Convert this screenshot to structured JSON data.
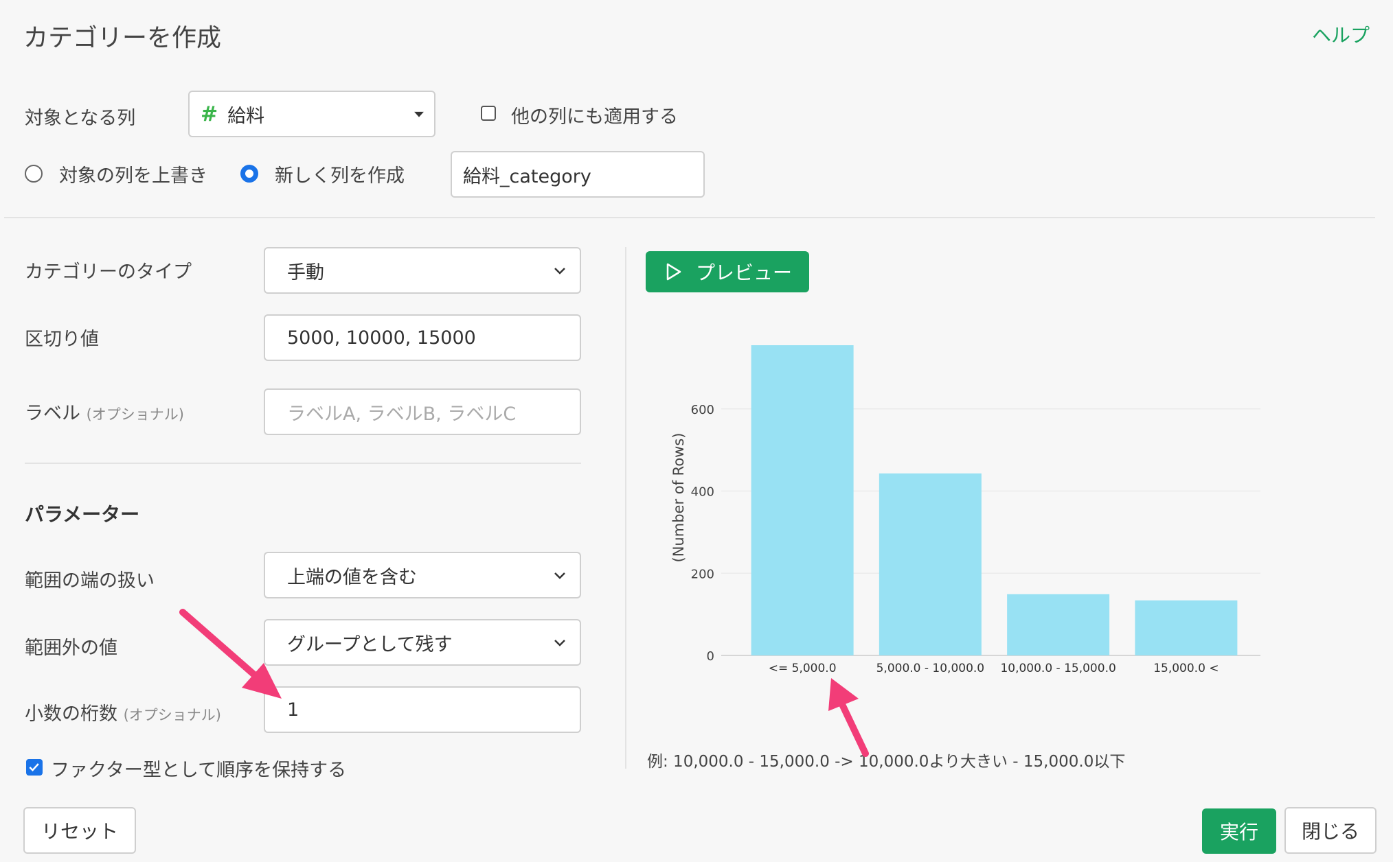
{
  "header": {
    "title": "カテゴリーを作成",
    "help": "ヘルプ"
  },
  "target": {
    "label": "対象となる列",
    "column_value": "給料",
    "apply_other_label": "他の列にも適用する",
    "overwrite_label": "対象の列を上書き",
    "new_column_label": "新しく列を作成",
    "new_column_value": "給料_category"
  },
  "form": {
    "category_type_label": "カテゴリーのタイプ",
    "category_type_value": "手動",
    "breaks_label": "区切り値",
    "breaks_value": "5000, 10000, 15000",
    "labels_label": "ラベル",
    "labels_optional": "(オプショナル)",
    "labels_placeholder": "ラベルA, ラベルB, ラベルC",
    "params_heading": "パラメーター",
    "range_edge_label": "範囲の端の扱い",
    "range_edge_value": "上端の値を含む",
    "out_of_range_label": "範囲外の値",
    "out_of_range_value": "グループとして残す",
    "decimals_label": "小数の桁数",
    "decimals_optional": "(オプショナル)",
    "decimals_value": "1",
    "factor_label": "ファクター型として順序を保持する"
  },
  "preview": {
    "button_label": "プレビュー",
    "example_text": "例: 10,000.0 - 15,000.0 -> 10,000.0より大きい - 15,000.0以下"
  },
  "footer": {
    "reset": "リセット",
    "run": "実行",
    "close": "閉じる"
  },
  "colors": {
    "accent": "#1aa260",
    "bar": "#98e1f3",
    "arrow": "#f23d78",
    "checkbox": "#1a73e8"
  },
  "chart_data": {
    "type": "bar",
    "categories": [
      "<= 5,000.0",
      "5,000.0 - 10,000.0",
      "10,000.0 - 15,000.0",
      "15,000.0 <"
    ],
    "values": [
      755,
      443,
      149,
      134
    ],
    "ylabel": "(Number of Rows)",
    "yticks": [
      0,
      200,
      400,
      600
    ],
    "ylim": [
      0,
      760
    ],
    "grid": true
  }
}
